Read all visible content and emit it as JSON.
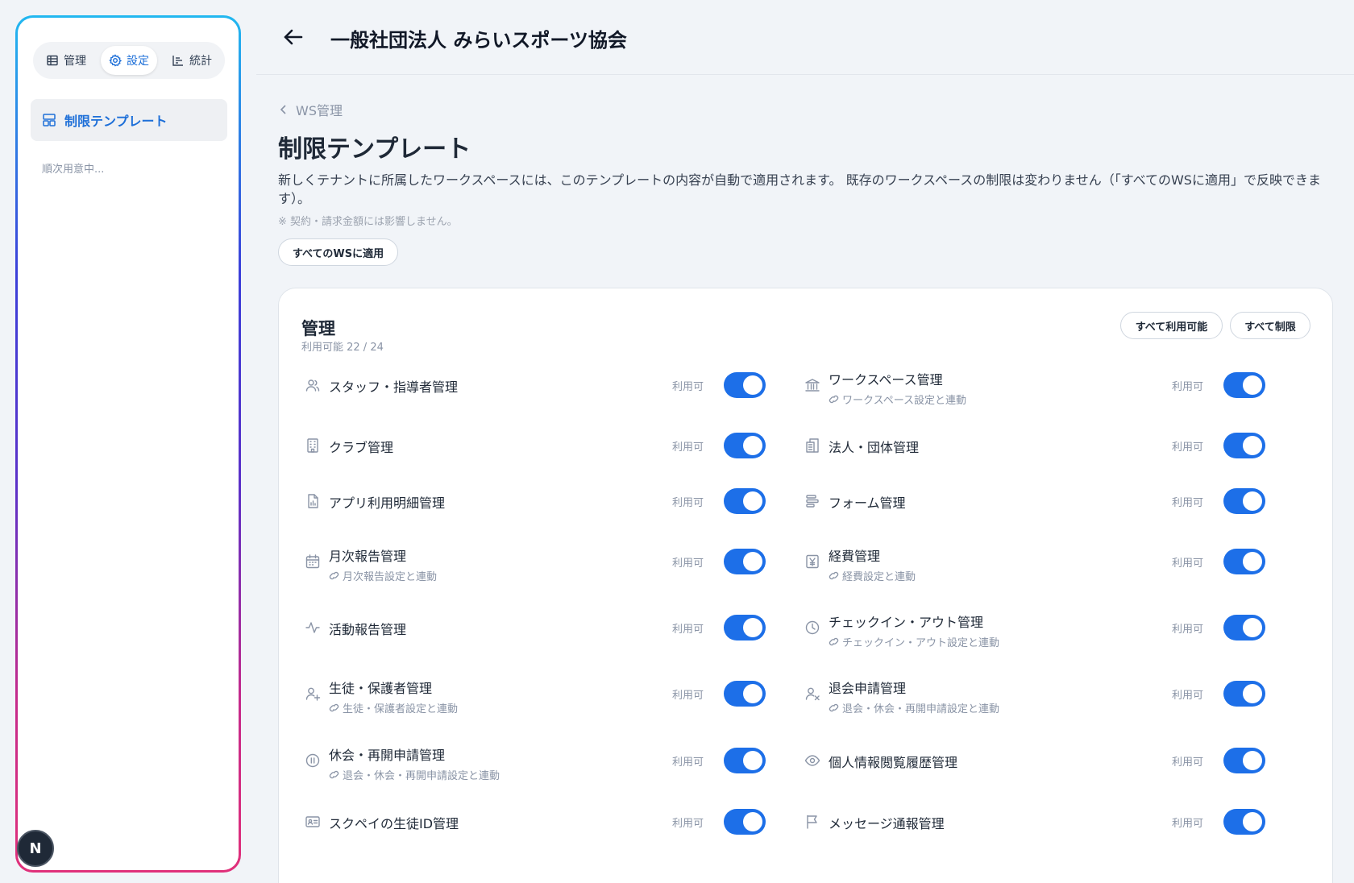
{
  "sidebar": {
    "tabs": [
      {
        "label": "管理",
        "icon": "table-icon"
      },
      {
        "label": "設定",
        "icon": "gear-icon"
      },
      {
        "label": "統計",
        "icon": "chart-icon"
      }
    ],
    "active_item": "制限テンプレート",
    "note": "順次用意中...",
    "badge": "N"
  },
  "header": {
    "title": "一般社団法人 みらいスポーツ協会"
  },
  "breadcrumb": "WS管理",
  "page": {
    "title": "制限テンプレート",
    "description": "新しくテナントに所属したワークスペースには、このテンプレートの内容が自動で適用されます。 既存のワークスペースの制限は変わりません（「すべてのWSに適用」で反映できます）。",
    "note": "※ 契約・請求金額には影響しません。",
    "apply_all_button": "すべてのWSに適用"
  },
  "section": {
    "title": "管理",
    "subtitle": "利用可能 22 / 24",
    "all_allow_button": "すべて利用可能",
    "all_restrict_button": "すべて制限",
    "items": [
      {
        "label": "スタッフ・指導者管理",
        "sub": "",
        "status": "利用可",
        "enabled": true,
        "icon": "users-icon"
      },
      {
        "label": "ワークスペース管理",
        "sub": "ワークスペース設定と連動",
        "status": "利用可",
        "enabled": true,
        "icon": "bank-icon"
      },
      {
        "label": "クラブ管理",
        "sub": "",
        "status": "利用可",
        "enabled": true,
        "icon": "building-icon"
      },
      {
        "label": "法人・団体管理",
        "sub": "",
        "status": "利用可",
        "enabled": true,
        "icon": "office-icon"
      },
      {
        "label": "アプリ利用明細管理",
        "sub": "",
        "status": "利用可",
        "enabled": true,
        "icon": "report-file-icon"
      },
      {
        "label": "フォーム管理",
        "sub": "",
        "status": "利用可",
        "enabled": true,
        "icon": "form-icon"
      },
      {
        "label": "月次報告管理",
        "sub": "月次報告設定と連動",
        "status": "利用可",
        "enabled": true,
        "icon": "calendar-icon"
      },
      {
        "label": "経費管理",
        "sub": "経費設定と連動",
        "status": "利用可",
        "enabled": true,
        "icon": "yen-icon"
      },
      {
        "label": "活動報告管理",
        "sub": "",
        "status": "利用可",
        "enabled": true,
        "icon": "activity-icon"
      },
      {
        "label": "チェックイン・アウト管理",
        "sub": "チェックイン・アウト設定と連動",
        "status": "利用可",
        "enabled": true,
        "icon": "clock-icon"
      },
      {
        "label": "生徒・保護者管理",
        "sub": "生徒・保護者設定と連動",
        "status": "利用可",
        "enabled": true,
        "icon": "user-plus-icon"
      },
      {
        "label": "退会申請管理",
        "sub": "退会・休会・再開申請設定と連動",
        "status": "利用可",
        "enabled": true,
        "icon": "user-x-icon"
      },
      {
        "label": "休会・再開申請管理",
        "sub": "退会・休会・再開申請設定と連動",
        "status": "利用可",
        "enabled": true,
        "icon": "pause-icon"
      },
      {
        "label": "個人情報閲覧履歴管理",
        "sub": "",
        "status": "利用可",
        "enabled": true,
        "icon": "eye-icon"
      },
      {
        "label": "スクペイの生徒ID管理",
        "sub": "",
        "status": "利用可",
        "enabled": true,
        "icon": "id-card-icon"
      },
      {
        "label": "メッセージ通報管理",
        "sub": "",
        "status": "利用可",
        "enabled": true,
        "icon": "flag-icon"
      }
    ]
  }
}
